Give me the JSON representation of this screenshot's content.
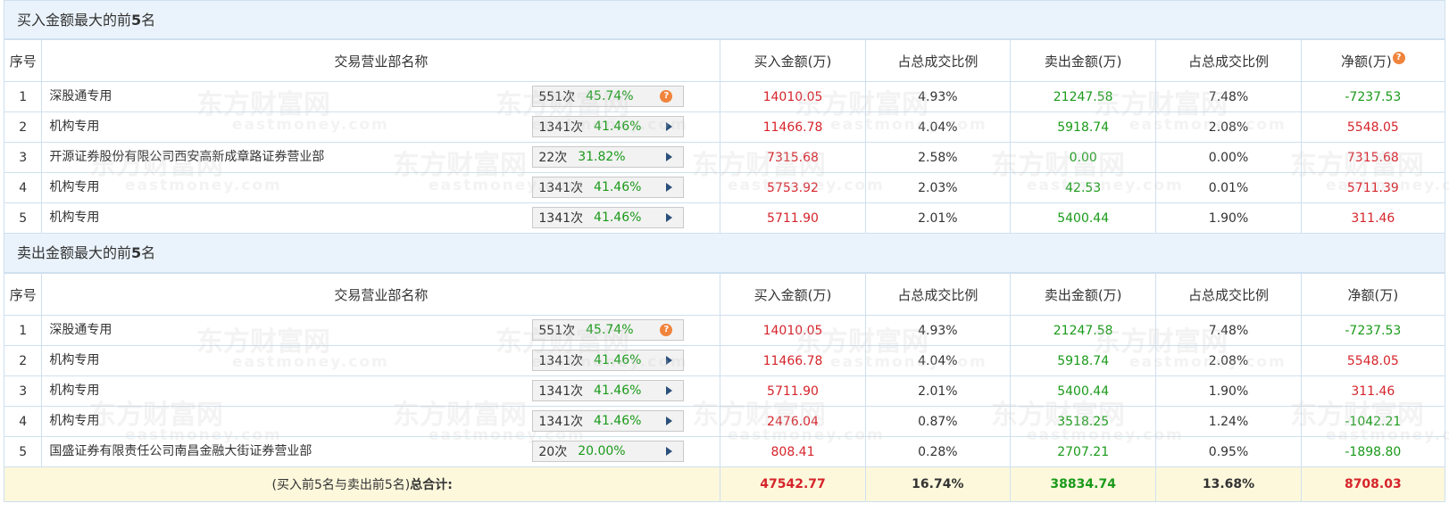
{
  "buy_section": {
    "title_prefix": "买入金额最大的前",
    "title_num": "5",
    "title_suffix": "名",
    "headers": [
      "序号",
      "交易营业部名称",
      "买入金额(万)",
      "占总成交比例",
      "卖出金额(万)",
      "占总成交比例",
      "净额(万)"
    ],
    "header_help": "?",
    "rows": [
      {
        "idx": "1",
        "name": "深股通专用",
        "count": "551次",
        "pct": "45.74%",
        "chip_icon": "question-icon",
        "buy": "14010.05",
        "buy_ratio": "4.93%",
        "sell": "21247.58",
        "sell_ratio": "7.48%",
        "net": "-7237.53",
        "net_color": "green"
      },
      {
        "idx": "2",
        "name": "机构专用",
        "count": "1341次",
        "pct": "41.46%",
        "chip_icon": "arrow-right-icon",
        "buy": "11466.78",
        "buy_ratio": "4.04%",
        "sell": "5918.74",
        "sell_ratio": "2.08%",
        "net": "5548.05",
        "net_color": "red"
      },
      {
        "idx": "3",
        "name": "开源证券股份有限公司西安高新成章路证券营业部",
        "count": "22次",
        "pct": "31.82%",
        "chip_icon": "arrow-right-icon",
        "buy": "7315.68",
        "buy_ratio": "2.58%",
        "sell": "0.00",
        "sell_ratio": "0.00%",
        "net": "7315.68",
        "net_color": "red"
      },
      {
        "idx": "4",
        "name": "机构专用",
        "count": "1341次",
        "pct": "41.46%",
        "chip_icon": "arrow-right-icon",
        "buy": "5753.92",
        "buy_ratio": "2.03%",
        "sell": "42.53",
        "sell_ratio": "0.01%",
        "net": "5711.39",
        "net_color": "red"
      },
      {
        "idx": "5",
        "name": "机构专用",
        "count": "1341次",
        "pct": "41.46%",
        "chip_icon": "arrow-right-icon",
        "buy": "5711.90",
        "buy_ratio": "2.01%",
        "sell": "5400.44",
        "sell_ratio": "1.90%",
        "net": "311.46",
        "net_color": "red"
      }
    ]
  },
  "sell_section": {
    "title_prefix": "卖出金额最大的前",
    "title_num": "5",
    "title_suffix": "名",
    "headers": [
      "序号",
      "交易营业部名称",
      "买入金额(万)",
      "占总成交比例",
      "卖出金额(万)",
      "占总成交比例",
      "净额(万)"
    ],
    "rows": [
      {
        "idx": "1",
        "name": "深股通专用",
        "count": "551次",
        "pct": "45.74%",
        "chip_icon": "question-icon",
        "buy": "14010.05",
        "buy_ratio": "4.93%",
        "sell": "21247.58",
        "sell_ratio": "7.48%",
        "net": "-7237.53",
        "net_color": "green"
      },
      {
        "idx": "2",
        "name": "机构专用",
        "count": "1341次",
        "pct": "41.46%",
        "chip_icon": "arrow-right-icon",
        "buy": "11466.78",
        "buy_ratio": "4.04%",
        "sell": "5918.74",
        "sell_ratio": "2.08%",
        "net": "5548.05",
        "net_color": "red"
      },
      {
        "idx": "3",
        "name": "机构专用",
        "count": "1341次",
        "pct": "41.46%",
        "chip_icon": "arrow-right-icon",
        "buy": "5711.90",
        "buy_ratio": "2.01%",
        "sell": "5400.44",
        "sell_ratio": "1.90%",
        "net": "311.46",
        "net_color": "red"
      },
      {
        "idx": "4",
        "name": "机构专用",
        "count": "1341次",
        "pct": "41.46%",
        "chip_icon": "arrow-right-icon",
        "buy": "2476.04",
        "buy_ratio": "0.87%",
        "sell": "3518.25",
        "sell_ratio": "1.24%",
        "net": "-1042.21",
        "net_color": "green"
      },
      {
        "idx": "5",
        "name": "国盛证券有限责任公司南昌金融大街证券营业部",
        "count": "20次",
        "pct": "20.00%",
        "chip_icon": "arrow-right-icon",
        "buy": "808.41",
        "buy_ratio": "0.28%",
        "sell": "2707.21",
        "sell_ratio": "0.95%",
        "net": "-1898.80",
        "net_color": "green"
      }
    ]
  },
  "total": {
    "label_prefix": "(买入前5名与卖出前5名)",
    "label_bold": "总合计:",
    "buy": "47542.77",
    "buy_ratio": "16.74%",
    "sell": "38834.74",
    "sell_ratio": "13.68%",
    "net": "8708.03"
  },
  "watermark": {
    "cn": "东方财富网",
    "en": "eastmoney.com"
  },
  "colors": {
    "red": "#d6242b",
    "green": "#1a9a1a",
    "header_bg": "#eaf3fb",
    "total_bg": "#fdf8dc",
    "border": "#cfe0ef"
  }
}
